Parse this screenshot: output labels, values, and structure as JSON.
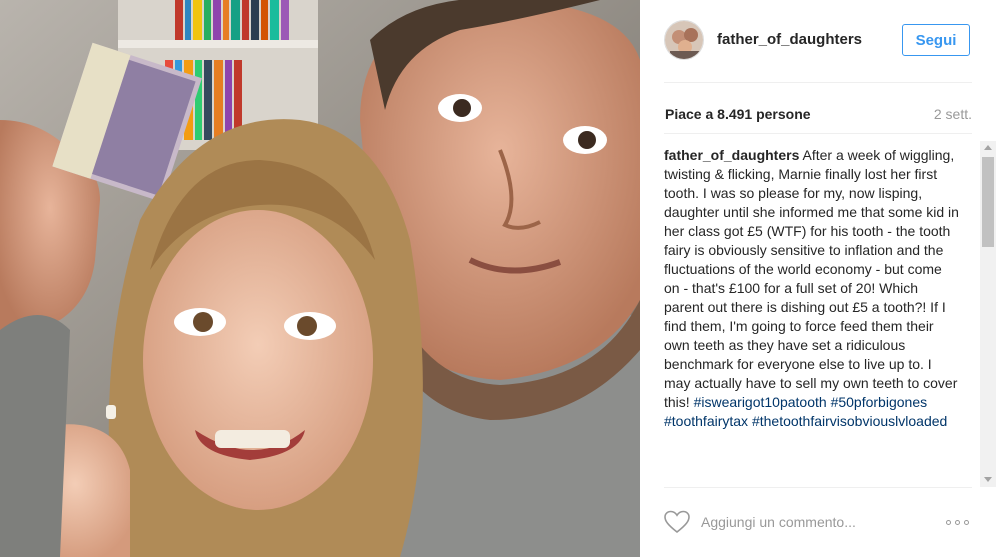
{
  "post": {
    "username": "father_of_daughters",
    "follow_label": "Segui",
    "likes_text": "Piace a 8.491 persone",
    "time_ago": "2 sett.",
    "caption_user": "father_of_daughters",
    "caption_text": "After a week of wiggling, twisting & flicking, Marnie finally lost her first tooth. I was so please for my, now lisping, daughter until she informed me that some kid in her class got £5 (WTF) for his tooth - the tooth fairy is obviously sensitive to inflation and the fluctuations of the world economy - but come on - that's £100 for a full set of 20! Which parent out there is dishing out £5 a tooth?! If I find them, I'm going to force feed them their own teeth as they have set a ridiculous benchmark for everyone else to live up to. I may actually have to sell my own teeth to cover this!",
    "hashtags": [
      "#iswearigot10patooth",
      "#50pforbigones",
      "#toothfairytax",
      "#thetoothfairvisobviouslvloaded"
    ],
    "comment_placeholder": "Aggiungi un commento..."
  },
  "icons": {
    "like": "heart-icon",
    "more": "more-options-icon"
  },
  "colors": {
    "follow_blue": "#3897f0",
    "hashtag": "#003569",
    "muted": "#999999"
  }
}
